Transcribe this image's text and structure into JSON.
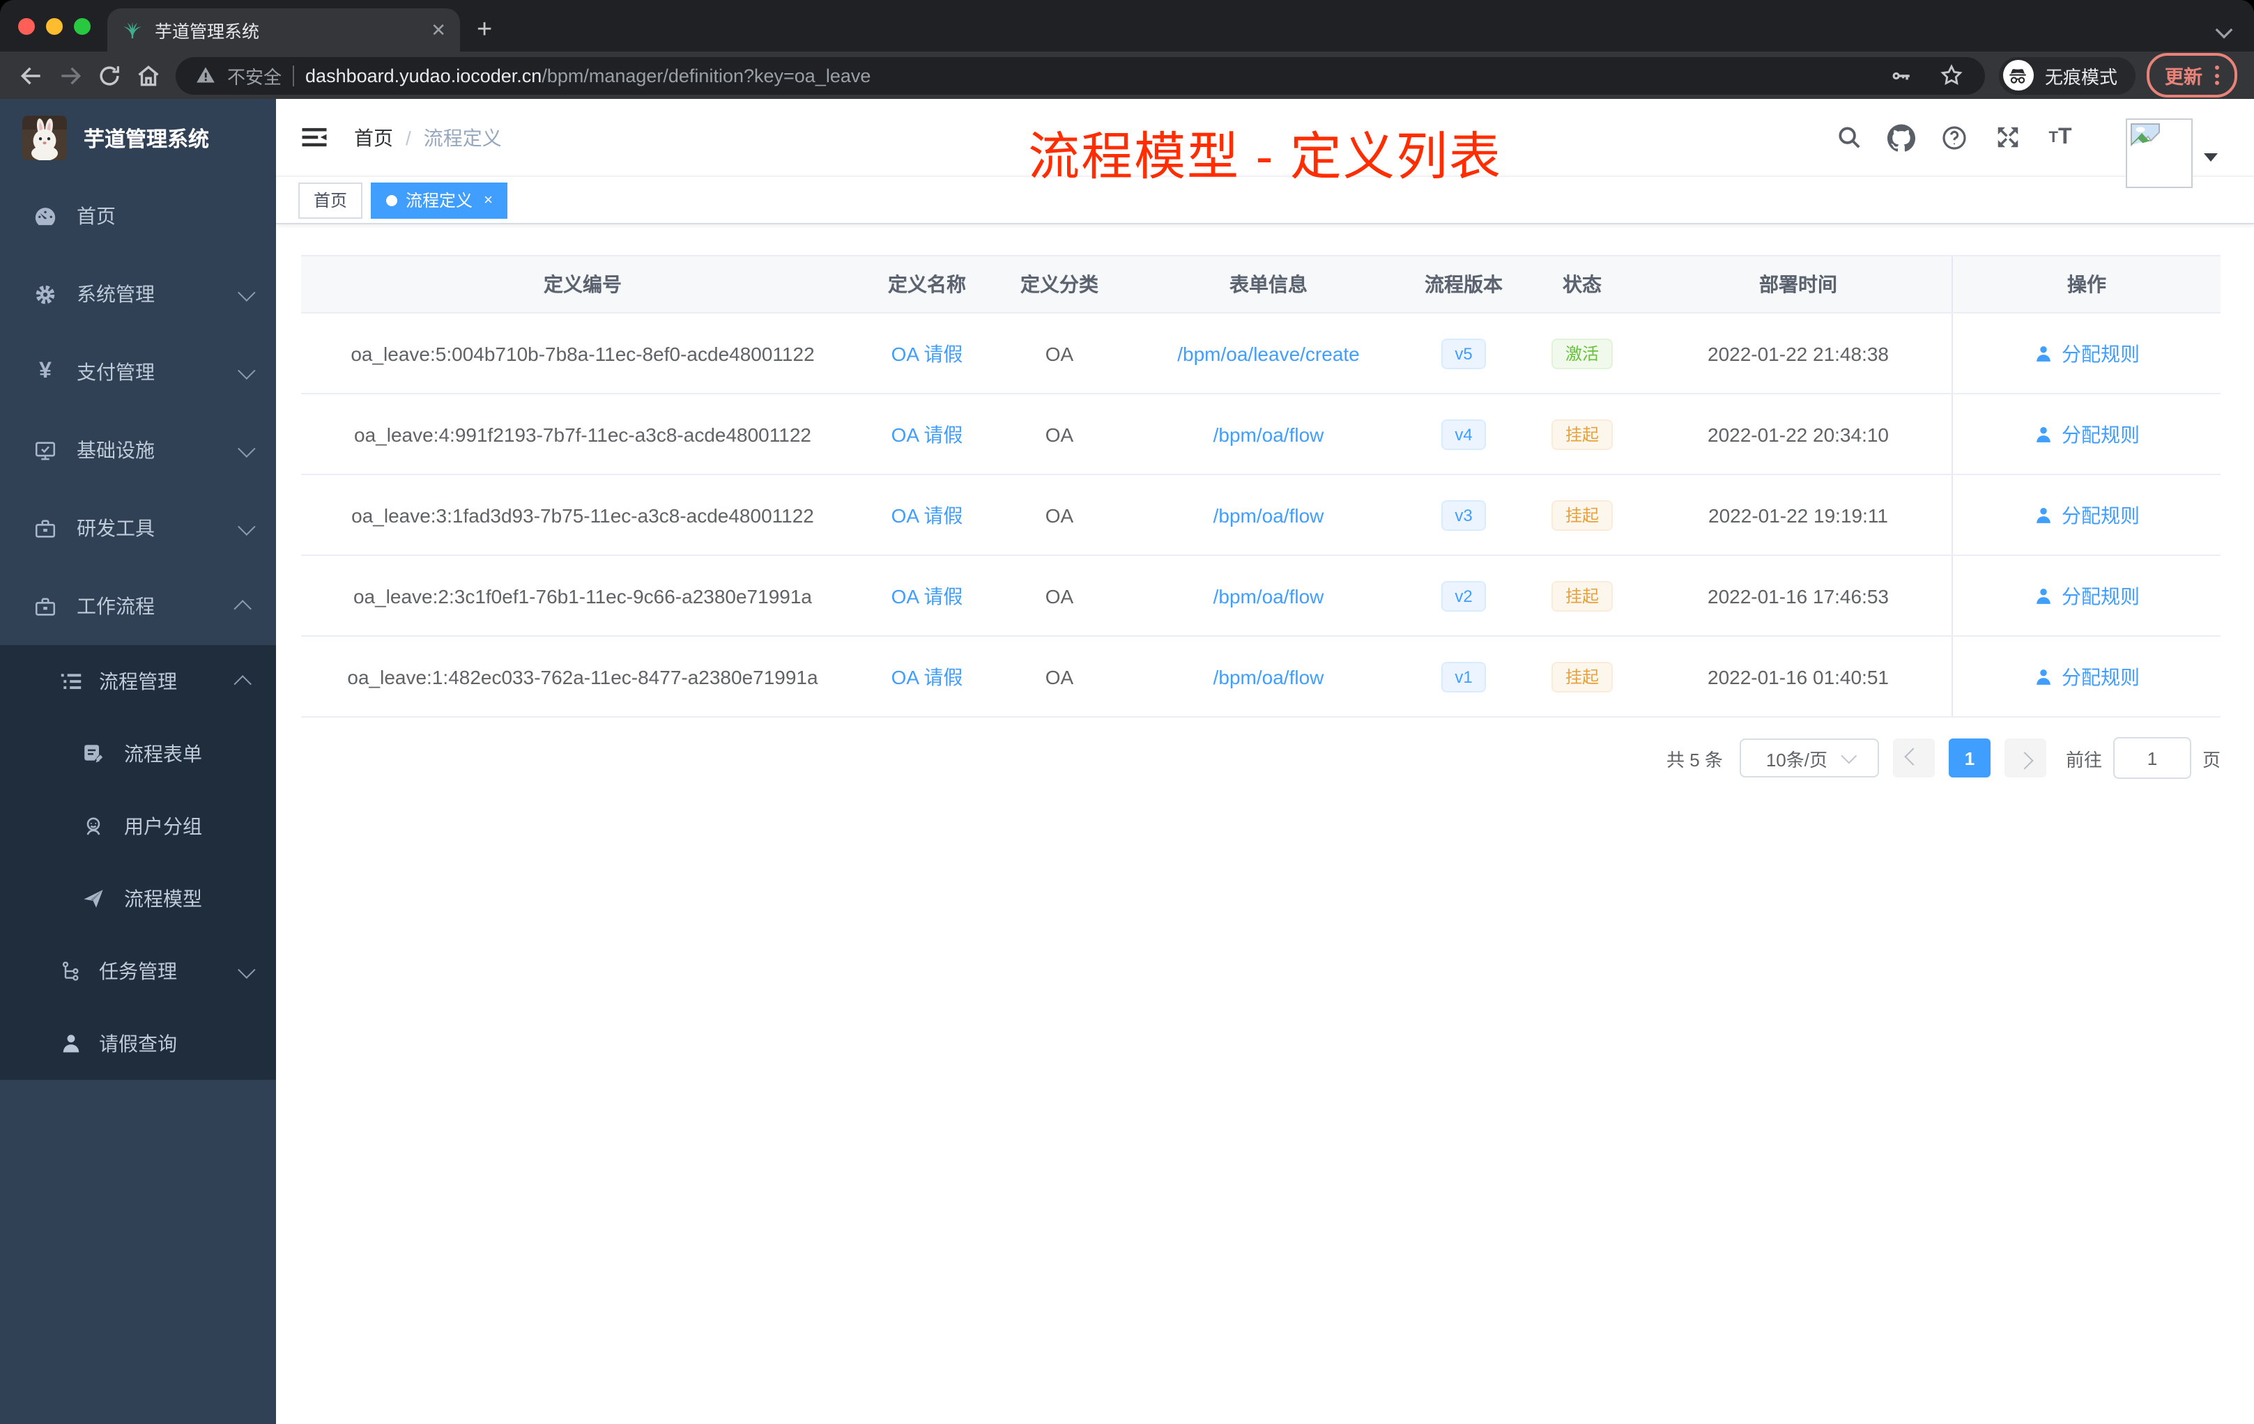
{
  "browser": {
    "tab_title": "芋道管理系统",
    "close_tab": "✕",
    "new_tab": "+",
    "not_secure_label": "不安全",
    "url_host": "dashboard.yudao.iocoder.cn",
    "url_path": "/bpm/manager/definition?key=oa_leave",
    "incognito_label": "无痕模式",
    "update_label": "更新"
  },
  "sidebar": {
    "logo_title": "芋道管理系统",
    "items": [
      {
        "label": "首页"
      },
      {
        "label": "系统管理"
      },
      {
        "label": "支付管理"
      },
      {
        "label": "基础设施"
      },
      {
        "label": "研发工具"
      },
      {
        "label": "工作流程"
      },
      {
        "label": "流程管理"
      },
      {
        "label": "流程表单"
      },
      {
        "label": "用户分组"
      },
      {
        "label": "流程模型"
      },
      {
        "label": "任务管理"
      },
      {
        "label": "请假查询"
      }
    ]
  },
  "navbar": {
    "breadcrumb": {
      "home": "首页",
      "separator": "/",
      "current": "流程定义"
    }
  },
  "annotation": {
    "text": "流程模型 - 定义列表",
    "color": "#ff2d00"
  },
  "tags": {
    "home": "首页",
    "active": "流程定义"
  },
  "table": {
    "columns": [
      "定义编号",
      "定义名称",
      "定义分类",
      "表单信息",
      "流程版本",
      "状态",
      "部署时间",
      "操作"
    ],
    "action_label": "分配规则",
    "rows": [
      {
        "id": "oa_leave:5:004b710b-7b8a-11ec-8ef0-acde48001122",
        "name": "OA 请假",
        "category": "OA",
        "form": "/bpm/oa/leave/create",
        "version": "v5",
        "status": "激活",
        "time": "2022-01-22 21:48:38"
      },
      {
        "id": "oa_leave:4:991f2193-7b7f-11ec-a3c8-acde48001122",
        "name": "OA 请假",
        "category": "OA",
        "form": "/bpm/oa/flow",
        "version": "v4",
        "status": "挂起",
        "time": "2022-01-22 20:34:10"
      },
      {
        "id": "oa_leave:3:1fad3d93-7b75-11ec-a3c8-acde48001122",
        "name": "OA 请假",
        "category": "OA",
        "form": "/bpm/oa/flow",
        "version": "v3",
        "status": "挂起",
        "time": "2022-01-22 19:19:11"
      },
      {
        "id": "oa_leave:2:3c1f0ef1-76b1-11ec-9c66-a2380e71991a",
        "name": "OA 请假",
        "category": "OA",
        "form": "/bpm/oa/flow",
        "version": "v2",
        "status": "挂起",
        "time": "2022-01-16 17:46:53"
      },
      {
        "id": "oa_leave:1:482ec033-762a-11ec-8477-a2380e71991a",
        "name": "OA 请假",
        "category": "OA",
        "form": "/bpm/oa/flow",
        "version": "v1",
        "status": "挂起",
        "time": "2022-01-16 01:40:51"
      }
    ]
  },
  "pagination": {
    "total": "共 5 条",
    "page_size": "10条/页",
    "current_page": "1",
    "goto_label": "前往",
    "goto_value": "1",
    "page_unit": "页"
  },
  "colors": {
    "accent": "#409eff",
    "success": "#67c23a",
    "warning": "#e6a23c",
    "sidebar": "#304156",
    "submenu": "#1f2d3d"
  }
}
